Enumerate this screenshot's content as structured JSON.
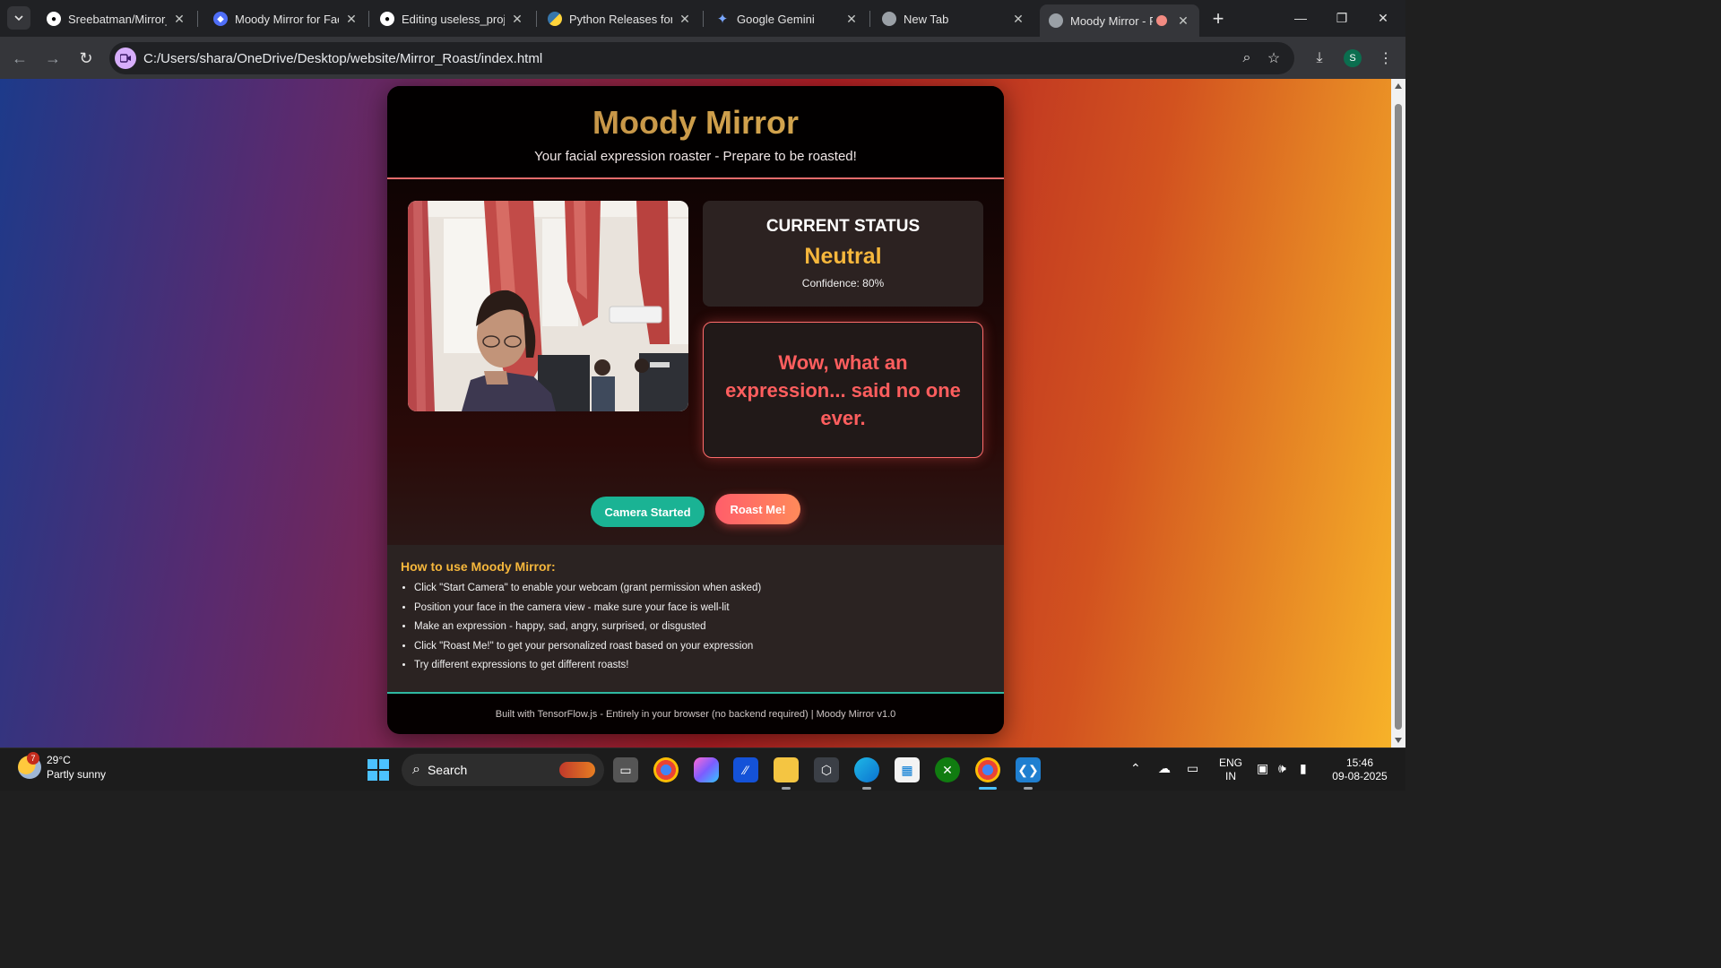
{
  "browser": {
    "tabs": [
      {
        "title": "Sreebatman/Mirror_R",
        "icon": "github-icon"
      },
      {
        "title": "Moody Mirror for Fac",
        "icon": "app-icon"
      },
      {
        "title": "Editing useless_proje",
        "icon": "github-icon"
      },
      {
        "title": "Python Releases for V",
        "icon": "python-icon"
      },
      {
        "title": "Google Gemini",
        "icon": "gemini-icon"
      },
      {
        "title": "New Tab",
        "icon": "chrome-icon"
      },
      {
        "title": "Moody Mirror - F",
        "icon": "globe-icon",
        "active": true
      }
    ],
    "url": "C:/Users/shara/OneDrive/Desktop/website/Mirror_Roast/index.html",
    "profile_initial": "S"
  },
  "app": {
    "title": "Moody Mirror",
    "subtitle": "Your facial expression roaster - Prepare to be roasted!",
    "status": {
      "label": "CURRENT STATUS",
      "value": "Neutral",
      "confidence": "Confidence: 80%"
    },
    "roast": "Wow, what an expression... said no one ever.",
    "buttons": {
      "camera": "Camera Started",
      "roast": "Roast Me!"
    },
    "howto": {
      "title": "How to use Moody Mirror:",
      "steps": [
        "Click \"Start Camera\" to enable your webcam (grant permission when asked)",
        "Position your face in the camera view - make sure your face is well-lit",
        "Make an expression - happy, sad, angry, surprised, or disgusted",
        "Click \"Roast Me!\" to get your personalized roast based on your expression",
        "Try different expressions to get different roasts!"
      ]
    },
    "footer": "Built with TensorFlow.js - Entirely in your browser (no backend required) | Moody Mirror v1.0"
  },
  "taskbar": {
    "weather_temp": "29°C",
    "weather_desc": "Partly sunny",
    "weather_badge": "7",
    "search_label": "Search",
    "lang_top": "ENG",
    "lang_bottom": "IN",
    "time": "15:46",
    "date": "09-08-2025"
  },
  "colors": {
    "accent_gold": "#f6b73c",
    "roast_red": "#ff5e5e",
    "camera_green": "#1ab394"
  }
}
